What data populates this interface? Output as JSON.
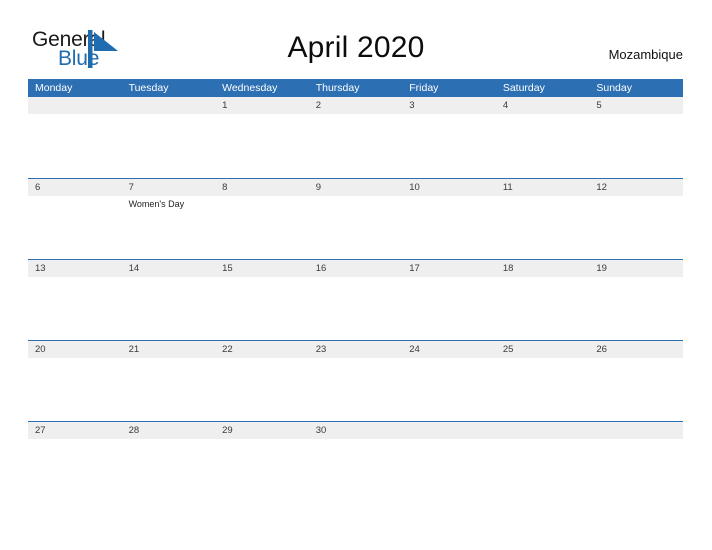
{
  "logo": {
    "text_primary": "General",
    "text_secondary": "Blue",
    "flag_color": "#1f6cb0"
  },
  "header": {
    "title": "April 2020",
    "country": "Mozambique"
  },
  "theme": {
    "header_blue": "#2d6fb3",
    "row_band_gray": "#efefef",
    "row_divider": "#2d6fb3",
    "page_background": "#ffffff"
  },
  "calendar": {
    "weekdays": [
      "Monday",
      "Tuesday",
      "Wednesday",
      "Thursday",
      "Friday",
      "Saturday",
      "Sunday"
    ],
    "weeks": [
      [
        {
          "day": "",
          "events": []
        },
        {
          "day": "",
          "events": []
        },
        {
          "day": "1",
          "events": []
        },
        {
          "day": "2",
          "events": []
        },
        {
          "day": "3",
          "events": []
        },
        {
          "day": "4",
          "events": []
        },
        {
          "day": "5",
          "events": []
        }
      ],
      [
        {
          "day": "6",
          "events": []
        },
        {
          "day": "7",
          "events": [
            "Women's Day"
          ]
        },
        {
          "day": "8",
          "events": []
        },
        {
          "day": "9",
          "events": []
        },
        {
          "day": "10",
          "events": []
        },
        {
          "day": "11",
          "events": []
        },
        {
          "day": "12",
          "events": []
        }
      ],
      [
        {
          "day": "13",
          "events": []
        },
        {
          "day": "14",
          "events": []
        },
        {
          "day": "15",
          "events": []
        },
        {
          "day": "16",
          "events": []
        },
        {
          "day": "17",
          "events": []
        },
        {
          "day": "18",
          "events": []
        },
        {
          "day": "19",
          "events": []
        }
      ],
      [
        {
          "day": "20",
          "events": []
        },
        {
          "day": "21",
          "events": []
        },
        {
          "day": "22",
          "events": []
        },
        {
          "day": "23",
          "events": []
        },
        {
          "day": "24",
          "events": []
        },
        {
          "day": "25",
          "events": []
        },
        {
          "day": "26",
          "events": []
        }
      ],
      [
        {
          "day": "27",
          "events": []
        },
        {
          "day": "28",
          "events": []
        },
        {
          "day": "29",
          "events": []
        },
        {
          "day": "30",
          "events": []
        },
        {
          "day": "",
          "events": []
        },
        {
          "day": "",
          "events": []
        },
        {
          "day": "",
          "events": []
        }
      ]
    ]
  }
}
